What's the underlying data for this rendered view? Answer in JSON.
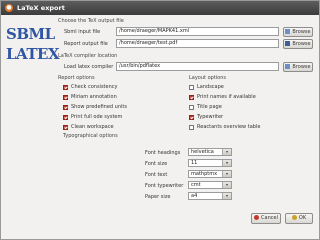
{
  "window": {
    "title": "LaTeX export"
  },
  "logo": {
    "line1": "SBML",
    "line2": "LATEX"
  },
  "output": {
    "section": "Choose the TeX output file",
    "sbml_label": "Sbml input file",
    "sbml_value": "/home/draeger/MAPK41.xml",
    "report_label": "Report output file",
    "report_value": "/home/draeger/test.pdf",
    "browse": "Browse"
  },
  "compiler": {
    "section": "LaTeX compiler location",
    "label": "Load latex compiler",
    "value": "/usr/bin/pdflatex",
    "browse": "Browse"
  },
  "report_options": {
    "title": "Report options",
    "items": [
      {
        "label": "Check consistency",
        "checked": true
      },
      {
        "label": "Miriam annotation",
        "checked": true
      },
      {
        "label": "Show predefined units",
        "checked": true
      },
      {
        "label": "Print full ode system",
        "checked": true
      },
      {
        "label": "Clean workspace",
        "checked": true
      }
    ]
  },
  "layout_options": {
    "title": "Layout options",
    "items": [
      {
        "label": "Landscape",
        "checked": false
      },
      {
        "label": "Print names if available",
        "checked": true
      },
      {
        "label": "Title page",
        "checked": false
      },
      {
        "label": "Typewriter",
        "checked": true
      },
      {
        "label": "Reactants overview table",
        "checked": false
      }
    ]
  },
  "typo": {
    "title": "Typographical options",
    "fields": [
      {
        "label": "Font headings",
        "value": "helvetica"
      },
      {
        "label": "Font size",
        "value": "11"
      },
      {
        "label": "Font text",
        "value": "mathptmx"
      },
      {
        "label": "Font typewriter",
        "value": "cmt"
      },
      {
        "label": "Paper size",
        "value": "a4"
      }
    ]
  },
  "actions": {
    "cancel": "Cancel",
    "ok": "OK"
  },
  "colors": {
    "checkbox": "#c0392b",
    "logo": "#2f56a3"
  }
}
